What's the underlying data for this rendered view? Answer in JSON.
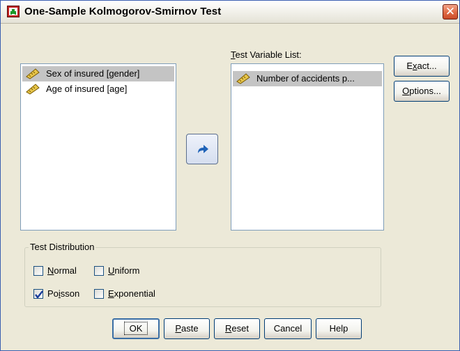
{
  "window": {
    "title": "One-Sample Kolmogorov-Smirnov Test",
    "close_glyph": "✕"
  },
  "source_list": {
    "items": [
      {
        "label": "Sex of insured [gender]",
        "selected": true,
        "icon": "ruler-icon"
      },
      {
        "label": "Age of insured [age]",
        "selected": false,
        "icon": "ruler-icon"
      }
    ]
  },
  "move_button": {
    "icon": "arrow-right-icon"
  },
  "test_list": {
    "label_mnemonic": "T",
    "label_rest": "est Variable List:",
    "items": [
      {
        "label": "Number of accidents p...",
        "selected": true,
        "icon": "ruler-icon"
      }
    ]
  },
  "side_buttons": {
    "exact": {
      "pre": "E",
      "mn": "x",
      "post": "act..."
    },
    "options": {
      "pre": "",
      "mn": "O",
      "post": "ptions..."
    }
  },
  "test_distribution": {
    "legend": "Test Distribution",
    "normal": {
      "mn": "N",
      "rest": "ormal",
      "checked": false
    },
    "uniform": {
      "mn": "U",
      "rest": "niform",
      "checked": false
    },
    "poisson": {
      "pre": "Po",
      "mn": "i",
      "post": "sson",
      "checked": true
    },
    "exponential": {
      "mn": "E",
      "rest": "xponential",
      "checked": false
    }
  },
  "buttons": {
    "ok": "OK",
    "paste": {
      "mn": "P",
      "rest": "aste"
    },
    "reset": {
      "mn": "R",
      "rest": "eset"
    },
    "cancel": "Cancel",
    "help": "Help"
  },
  "colors": {
    "selection": "#c4c4c4",
    "checkmark": "#1a3d9a",
    "arrow": "#1f63b8",
    "close": "#e06a44"
  }
}
